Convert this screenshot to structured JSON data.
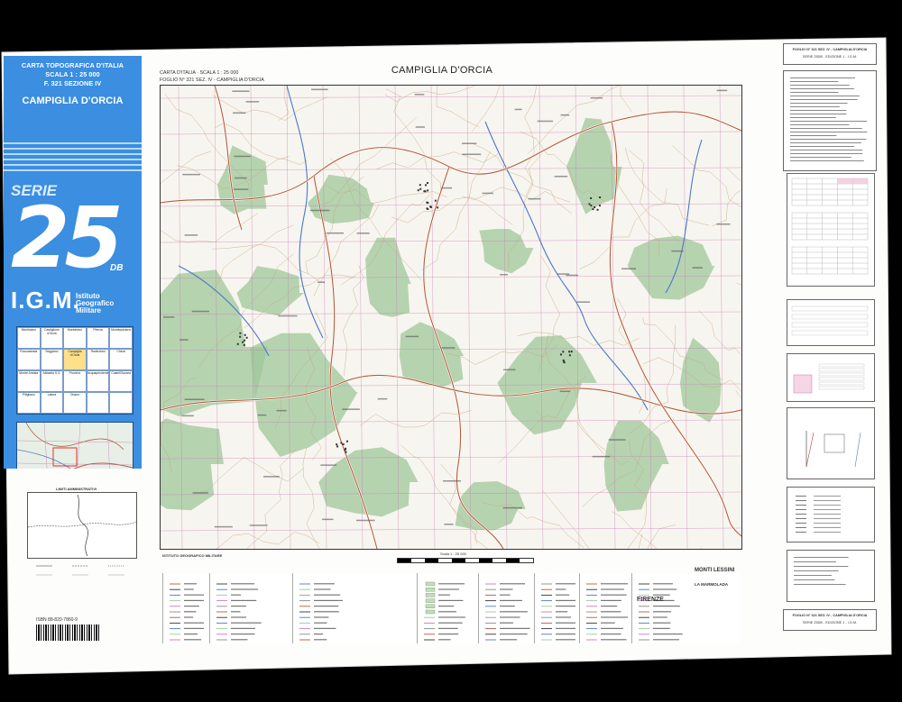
{
  "cover": {
    "line1": "CARTA TOPOGRAFICA D'ITALIA",
    "line2": "SCALA  1 : 25 000",
    "line3": "F. 321 SEZIONE IV",
    "name": "CAMPIGLIA D'ORCIA",
    "serie": "SERIE",
    "series_number": "25",
    "series_suffix": "DB",
    "igm": "I.G.M.",
    "igm_sub1": "Istituto",
    "igm_sub2": "Geografico",
    "igm_sub3": "Militare"
  },
  "index_sheets": [
    "Monticiano",
    "Castiglione d'Orcia",
    "Montalcino",
    "Pienza",
    "Montepulciano",
    "Roccastrada",
    "Seggiano",
    "Campiglia d'Orcia",
    "Radicofani",
    "Chiusi",
    "Monte Amiata",
    "Abbadia S.S.",
    "Proceno",
    "Acquapendente",
    "Castell'Azzara",
    "Pitigliano",
    "Latera",
    "Onano"
  ],
  "admin": {
    "title": "LIMITI AMMINISTRATIVI",
    "isbn": "ISBN 88-820-7860-9"
  },
  "header": {
    "left1": "CARTA D'ITALIA  ·  SCALA 1 : 25 000",
    "left2": "FOGLIO N° 321 SEZ. IV  -  CAMPIGLIA D'ORCIA",
    "title": "CAMPIGLIA D'ORCIA"
  },
  "right": {
    "top_title": "FOGLIO N° 321 SEZ. IV - CAMPIGLIA D'ORCIA",
    "top_sub": "SERIE 25DB - EDIZIONE 1 - I.G.M.",
    "bottom_title": "FOGLIO N° 321 SEZ. IV - CAMPIGLIA D'ORCIA",
    "bottom_sub": "SERIE 25DB - EDIZIONE 1 - I.G.M."
  },
  "footer": {
    "publisher": "ISTITUTO GEOGRAFICO MILITARE",
    "scale_text": "Scala 1 : 25 000",
    "place1": "FIRENZE",
    "place2": "MONTI LESSINI",
    "place3": "LA MARMOLADA"
  },
  "colors": {
    "cover": "#3b8ee0",
    "map_bg": "#f7f5ef",
    "forest": "#9fc79a",
    "water": "#4a78c8",
    "road": "#b55a3a",
    "contour": "#c8a27a",
    "grid": "#c77bb8"
  }
}
